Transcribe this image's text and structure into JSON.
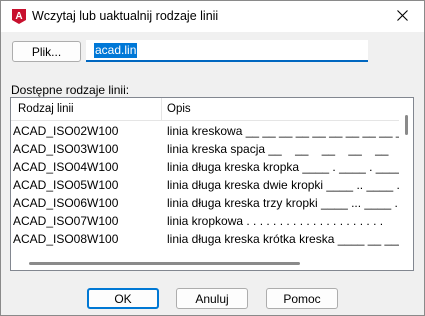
{
  "window": {
    "title": "Wczytaj lub uaktualnij rodzaje linii",
    "icon": "autocad-a-icon",
    "accent_color": "#c8102e"
  },
  "file": {
    "button_label": "Plik...",
    "value": "acad.lin"
  },
  "linetypes": {
    "label": "Dostępne rodzaje linii:",
    "columns": [
      "Rodzaj linii",
      "Opis"
    ],
    "rows": [
      {
        "name": "ACAD_ISO02W100",
        "description": "linia kreskowa __ __ __ __ __ __ __ __ __ __ __ __ _"
      },
      {
        "name": "ACAD_ISO03W100",
        "description": "linia kreska spacja __    __    __    __    __    __"
      },
      {
        "name": "ACAD_ISO04W100",
        "description": "linia długa kreska kropka ____ . ____ . ____ . _"
      },
      {
        "name": "ACAD_ISO05W100",
        "description": "linia długa kreska dwie kropki ____ .. ____ .."
      },
      {
        "name": "ACAD_ISO06W100",
        "description": "linia długa kreska trzy kropki ____ ... ____ ."
      },
      {
        "name": "ACAD_ISO07W100",
        "description": "linia kropkowa . . . . . . . . . . . . . . . . . . . . ."
      },
      {
        "name": "ACAD_ISO08W100",
        "description": "linia długa kreska krótka kreska ____ __ ____"
      }
    ]
  },
  "buttons": {
    "ok": "OK",
    "cancel": "Anuluj",
    "help": "Pomoc"
  }
}
